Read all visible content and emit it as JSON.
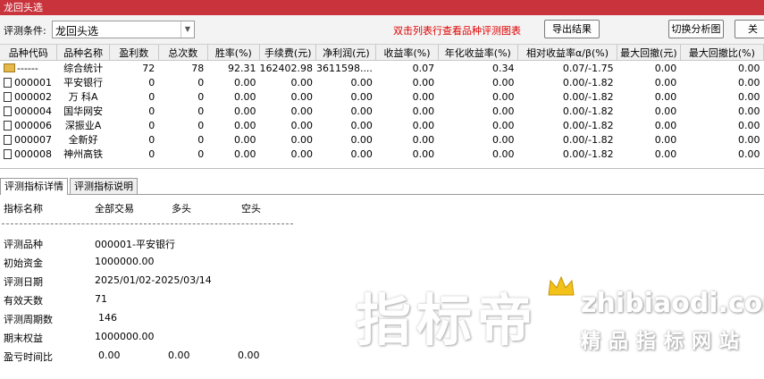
{
  "window": {
    "title": "龙回头选"
  },
  "toolbar": {
    "condition_label": "评测条件:",
    "condition_value": "龙回头选",
    "hint": "双击列表行查看品种评测图表",
    "export_label": "导出结果",
    "switch_label": "切换分析图",
    "close_label": "关"
  },
  "table": {
    "columns": [
      "品种代码",
      "品种名称",
      "盈利数",
      "总次数",
      "胜率(%)",
      "手续费(元)",
      "净利润(元)",
      "收益率(%)",
      "年化收益率(%)",
      "相对收益率α/β(%)",
      "最大回撤(元)",
      "最大回撤比(%)"
    ],
    "rows": [
      {
        "code": "------",
        "name": "综合统计",
        "win": "72",
        "total": "78",
        "rate": "92.31",
        "fee": "162402.98",
        "profit": "3611598....",
        "ret": "0.07",
        "annual": "0.34",
        "rel": "0.07/-1.75",
        "dd": "0.00",
        "ddp": "0.00"
      },
      {
        "code": "000001",
        "name": "平安银行",
        "win": "0",
        "total": "0",
        "rate": "0.00",
        "fee": "0.00",
        "profit": "0.00",
        "ret": "0.00",
        "annual": "0.00",
        "rel": "0.00/-1.82",
        "dd": "0.00",
        "ddp": "0.00"
      },
      {
        "code": "000002",
        "name": "万 科A",
        "win": "0",
        "total": "0",
        "rate": "0.00",
        "fee": "0.00",
        "profit": "0.00",
        "ret": "0.00",
        "annual": "0.00",
        "rel": "0.00/-1.82",
        "dd": "0.00",
        "ddp": "0.00"
      },
      {
        "code": "000004",
        "name": "国华网安",
        "win": "0",
        "total": "0",
        "rate": "0.00",
        "fee": "0.00",
        "profit": "0.00",
        "ret": "0.00",
        "annual": "0.00",
        "rel": "0.00/-1.82",
        "dd": "0.00",
        "ddp": "0.00"
      },
      {
        "code": "000006",
        "name": "深振业A",
        "win": "0",
        "total": "0",
        "rate": "0.00",
        "fee": "0.00",
        "profit": "0.00",
        "ret": "0.00",
        "annual": "0.00",
        "rel": "0.00/-1.82",
        "dd": "0.00",
        "ddp": "0.00"
      },
      {
        "code": "000007",
        "name": "全新好",
        "win": "0",
        "total": "0",
        "rate": "0.00",
        "fee": "0.00",
        "profit": "0.00",
        "ret": "0.00",
        "annual": "0.00",
        "rel": "0.00/-1.82",
        "dd": "0.00",
        "ddp": "0.00"
      },
      {
        "code": "000008",
        "name": "神州高铁",
        "win": "0",
        "total": "0",
        "rate": "0.00",
        "fee": "0.00",
        "profit": "0.00",
        "ret": "0.00",
        "annual": "0.00",
        "rel": "0.00/-1.82",
        "dd": "0.00",
        "ddp": "0.00"
      }
    ]
  },
  "tabs": {
    "detail": "评测指标详情",
    "explain": "评测指标说明"
  },
  "detail": {
    "head_name": "指标名称",
    "head_all": "全部交易",
    "head_long": "多头",
    "head_short": "空头",
    "items": [
      {
        "label": "评测品种",
        "value": "000001-平安银行"
      },
      {
        "label": "初始资金",
        "value": "1000000.00"
      },
      {
        "label": "评测日期",
        "value": "2025/01/02-2025/03/14"
      },
      {
        "label": "有效天数",
        "value": "71"
      },
      {
        "label": "评测周期数",
        "value": "146"
      },
      {
        "label": "期末权益",
        "value": "1000000.00"
      },
      {
        "label": "盈亏时间比",
        "value": "0.00",
        "value2": "0.00",
        "value3": "0.00"
      }
    ]
  },
  "watermark": {
    "cn": "指标帝",
    "en": "zhibiaodi.com",
    "tag": "精品指标网站"
  },
  "colors": {
    "title_bg": "#c8333c",
    "hint": "#e00000"
  },
  "icons": {
    "doc": "document-icon",
    "folder": "folder-icon",
    "dropdown": "chevron-down-icon"
  }
}
